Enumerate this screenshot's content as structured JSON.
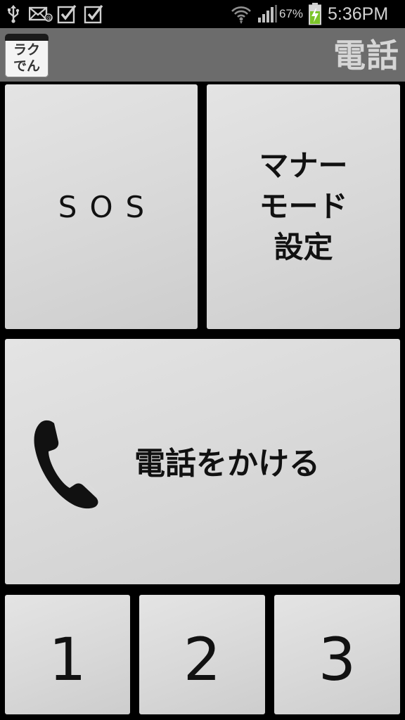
{
  "status_bar": {
    "battery_percent": "67%",
    "time": "5:36PM",
    "icons": [
      "usb-icon",
      "mail-icon",
      "check-icon",
      "check-icon",
      "wifi-icon",
      "signal-icon",
      "battery-icon"
    ]
  },
  "app_bar": {
    "logo_line1": "ラク",
    "logo_line2": "でん",
    "title": "電話"
  },
  "tiles": {
    "sos_label": "SOS",
    "manner_line1": "マナー",
    "manner_line2": "モード",
    "manner_line3": "設定",
    "call_label": "電話をかける",
    "number_1": "1",
    "number_2": "2",
    "number_3": "3"
  },
  "colors": {
    "background": "#000000",
    "app_bar": "#6c6c6c",
    "tile": "#dcdcdc",
    "battery_charge": "#7cc42a"
  }
}
